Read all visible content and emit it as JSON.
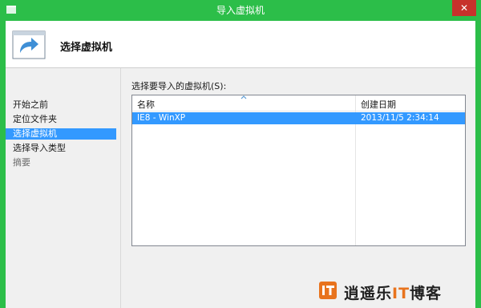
{
  "window": {
    "title": "导入虚拟机",
    "close_glyph": "✕"
  },
  "header": {
    "title": "选择虚拟机",
    "icon": "arrow-right-icon"
  },
  "nav": {
    "items": [
      {
        "label": "开始之前",
        "state": "normal"
      },
      {
        "label": "定位文件夹",
        "state": "normal"
      },
      {
        "label": "选择虚拟机",
        "state": "active"
      },
      {
        "label": "选择导入类型",
        "state": "normal"
      },
      {
        "label": "摘要",
        "state": "disabled"
      }
    ]
  },
  "content": {
    "label": "选择要导入的虚拟机(S):",
    "columns": [
      "名称",
      "创建日期"
    ],
    "rows": [
      {
        "name": "IE8 - WinXP",
        "date": "2013/11/5 2:34:14",
        "selected": true
      }
    ]
  },
  "watermark": {
    "badge": "IT",
    "text_a": "逍遥乐",
    "text_b": "IT",
    "text_c": "博客"
  },
  "colors": {
    "frame": "#2cbe49",
    "selection": "#3399ff",
    "close": "#c7322b",
    "watermark_accent": "#e8731d"
  }
}
